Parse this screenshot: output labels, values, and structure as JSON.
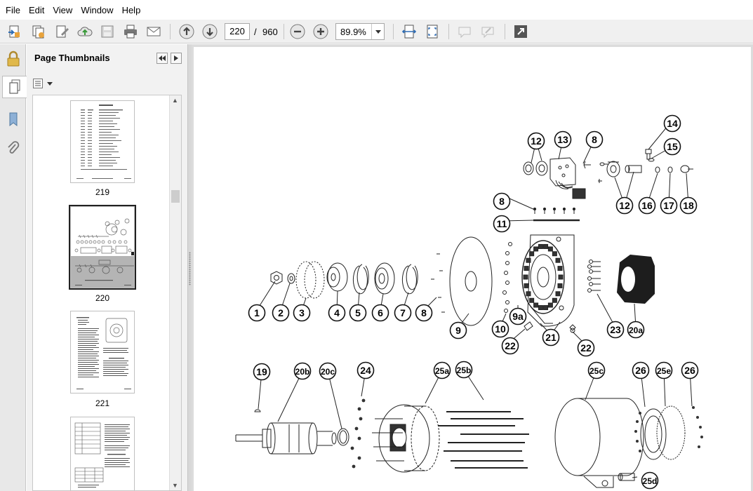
{
  "menu": [
    "File",
    "Edit",
    "View",
    "Window",
    "Help"
  ],
  "toolbar": {
    "current_page": "220",
    "page_separator": "/",
    "total_pages": "960",
    "zoom": "89.9%"
  },
  "panel": {
    "title": "Page Thumbnails",
    "thumbnails": [
      {
        "label": "219"
      },
      {
        "label": "220"
      },
      {
        "label": "221"
      },
      {
        "label": ""
      }
    ]
  },
  "diagram": {
    "callouts": [
      "1",
      "2",
      "3",
      "4",
      "5",
      "6",
      "7",
      "8",
      "9",
      "10",
      "9a",
      "21",
      "22",
      "22",
      "23",
      "20a",
      "8",
      "11",
      "12",
      "13",
      "8",
      "14",
      "15",
      "12",
      "16",
      "17",
      "18",
      "19",
      "20b",
      "20c",
      "24",
      "25a",
      "25b",
      "25c",
      "26",
      "25e",
      "26",
      "25d"
    ]
  },
  "colors": {
    "toolbar_bg": "#f0f0f0",
    "panel_bg": "#f2f2f2",
    "document_bg": "#dcdcdc",
    "icon_blue": "#2f6db5"
  }
}
